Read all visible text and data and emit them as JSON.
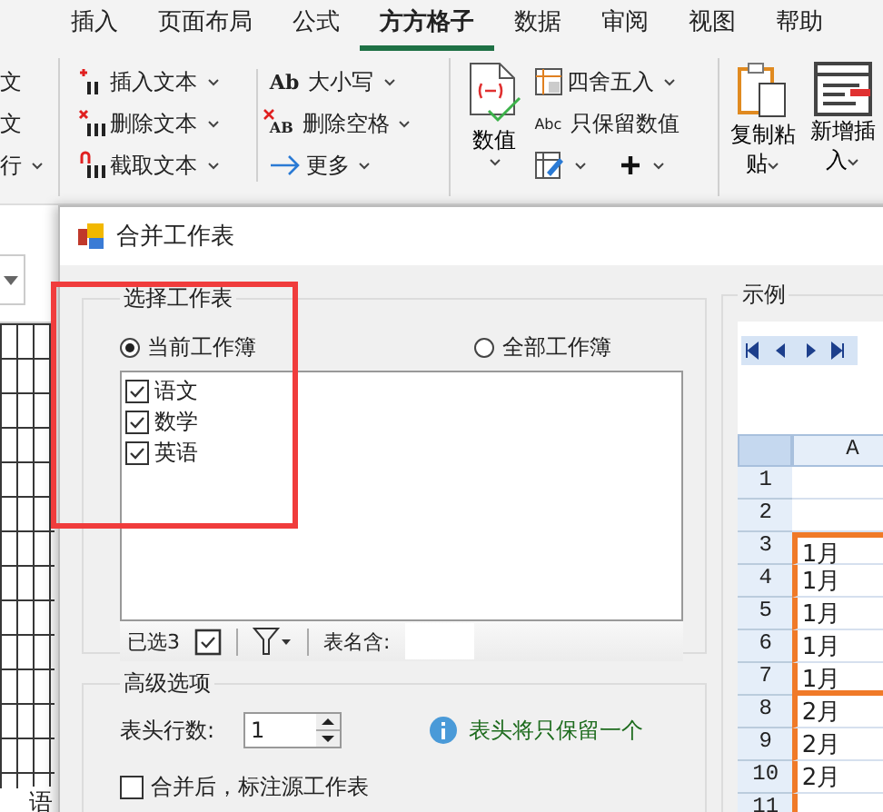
{
  "ribbon": {
    "tabs": [
      {
        "label": "插入",
        "selected": false
      },
      {
        "label": "页面布局",
        "selected": false
      },
      {
        "label": "公式",
        "selected": false
      },
      {
        "label": "方方格子",
        "selected": true
      },
      {
        "label": "数据",
        "selected": false
      },
      {
        "label": "审阅",
        "selected": false
      },
      {
        "label": "视图",
        "selected": false
      },
      {
        "label": "帮助",
        "selected": false
      }
    ],
    "left_column": [
      {
        "label": "文",
        "dropdown": false
      },
      {
        "label": "文",
        "dropdown": false
      },
      {
        "label": "行",
        "dropdown": true
      }
    ],
    "text_tools": [
      {
        "kind": "insert",
        "label": "插入文本",
        "dropdown": true
      },
      {
        "kind": "delete",
        "label": "删除文本",
        "dropdown": true
      },
      {
        "kind": "extract",
        "label": "截取文本",
        "dropdown": true
      }
    ],
    "case_tools": [
      {
        "kind": "case",
        "icon_text": "Ab",
        "label": "大小写",
        "dropdown": true
      },
      {
        "kind": "space",
        "icon_text": "AB",
        "label": "删除空格",
        "dropdown": true
      },
      {
        "kind": "more",
        "label": "更多",
        "dropdown": true
      }
    ],
    "value_button": {
      "label": "数值",
      "dropdown": true
    },
    "number_tools": [
      {
        "kind": "round",
        "label": "四舍五入",
        "dropdown": true
      },
      {
        "kind": "keep",
        "icon_text": "Abc",
        "label": "只保留数值",
        "dropdown": false
      }
    ],
    "icon_tools": [
      {
        "kind": "edit",
        "dropdown": true
      },
      {
        "kind": "plus",
        "dropdown": true
      }
    ],
    "clipboard": [
      {
        "kind": "copy",
        "label": "复制粘",
        "label2": "贴",
        "dropdown": true
      },
      {
        "kind": "insert",
        "label": "新增插",
        "label2": "入",
        "dropdown": true
      }
    ]
  },
  "sheet": {
    "tab": "语"
  },
  "dialog": {
    "title": "合并工作表",
    "select_group": {
      "title": "选择工作表",
      "scopes": [
        {
          "label": "当前工作簿",
          "selected": true
        },
        {
          "label": "全部工作簿",
          "selected": false
        }
      ],
      "sheets": [
        {
          "label": "语文",
          "checked": true
        },
        {
          "label": "数学",
          "checked": true
        },
        {
          "label": "英语",
          "checked": true
        }
      ],
      "selected_count": "已选3",
      "name_filter_label": "表名含:"
    },
    "advanced": {
      "title": "高级选项",
      "header_rows_label": "表头行数:",
      "header_rows": "1",
      "hint": "表头将只保留一个",
      "mark_source": {
        "label": "合并后，标注源工作表",
        "checked": false
      }
    },
    "example": {
      "title": "示例",
      "column": "A",
      "rows": [
        {
          "num": "1",
          "cell": ""
        },
        {
          "num": "2",
          "cell": ""
        },
        {
          "num": "3",
          "cell": "1月"
        },
        {
          "num": "4",
          "cell": "1月"
        },
        {
          "num": "5",
          "cell": "1月"
        },
        {
          "num": "6",
          "cell": "1月"
        },
        {
          "num": "7",
          "cell": "1月"
        },
        {
          "num": "8",
          "cell": "2月"
        },
        {
          "num": "9",
          "cell": "2月"
        },
        {
          "num": "10",
          "cell": "2月"
        },
        {
          "num": "11",
          "cell": ""
        }
      ]
    }
  }
}
